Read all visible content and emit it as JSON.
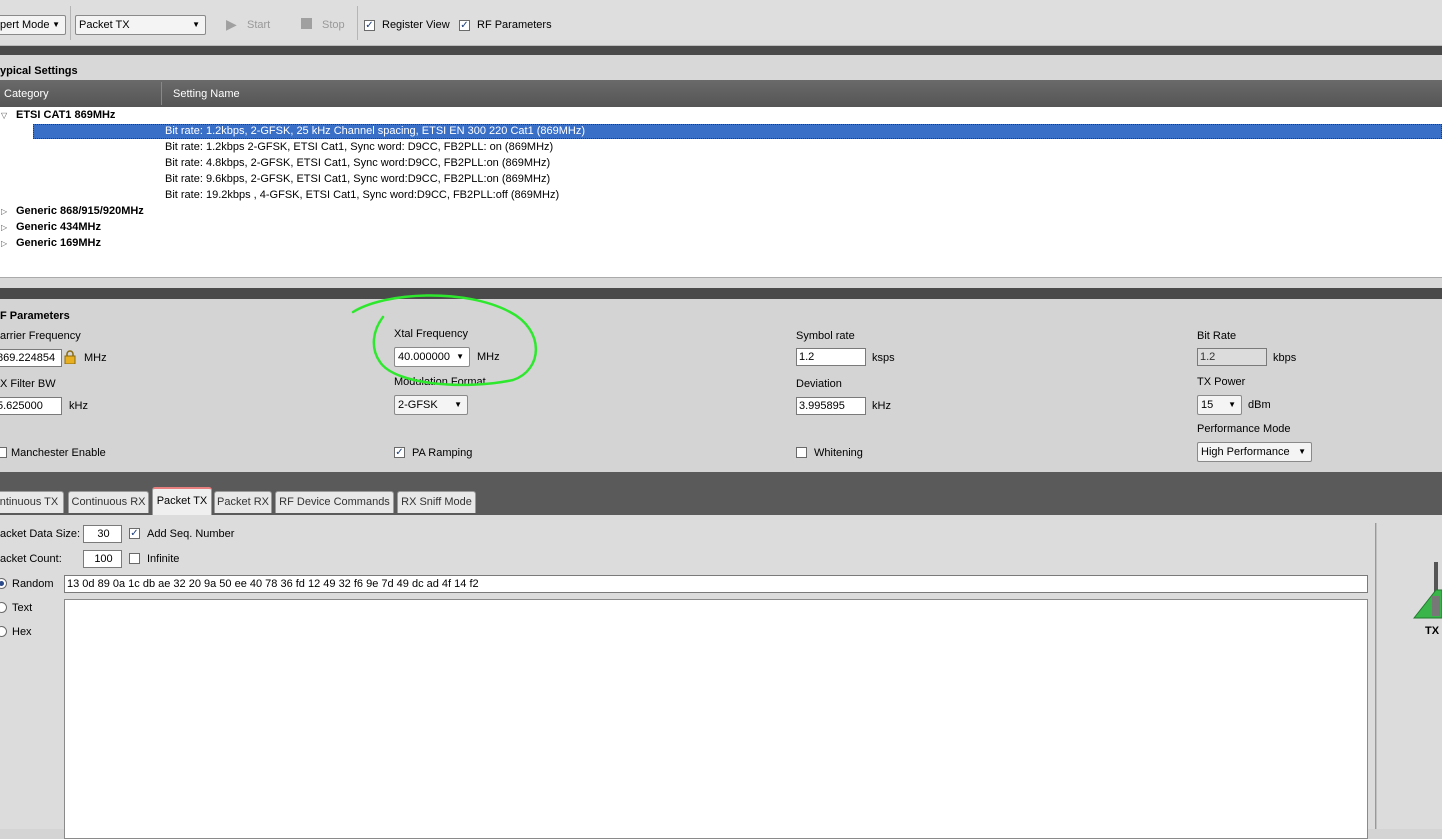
{
  "toolbar": {
    "mode_select": "pert Mode",
    "function_select": "Packet TX",
    "start_label": "Start",
    "stop_label": "Stop",
    "register_view_label": "Register View",
    "register_view_checked": true,
    "rf_parameters_label": "RF Parameters",
    "rf_parameters_checked": true
  },
  "typical_settings": {
    "title": "ypical Settings",
    "col_category": "Category",
    "col_setting_name": "Setting Name",
    "categories": [
      {
        "name": "ETSI CAT1 869MHz",
        "expanded": true,
        "settings": [
          "Bit rate: 1.2kbps, 2-GFSK, 25 kHz Channel spacing, ETSI EN 300 220 Cat1 (869MHz)",
          "Bit rate: 1.2kbps  2-GFSK, ETSI Cat1, Sync word: D9CC, FB2PLL: on (869MHz)",
          "Bit rate: 4.8kbps, 2-GFSK, ETSI Cat1, Sync word:D9CC, FB2PLL:on (869MHz)",
          "Bit rate: 9.6kbps, 2-GFSK, ETSI Cat1, Sync word:D9CC, FB2PLL:on (869MHz)",
          "Bit rate: 19.2kbps , 4-GFSK, ETSI Cat1, Sync word:D9CC, FB2PLL:off (869MHz)"
        ]
      },
      {
        "name": "Generic 868/915/920MHz",
        "expanded": false
      },
      {
        "name": "Generic 434MHz",
        "expanded": false
      },
      {
        "name": "Generic 169MHz",
        "expanded": false
      }
    ]
  },
  "rf_parameters": {
    "title": "F Parameters",
    "carrier_frequency": {
      "label": "arrier Frequency",
      "value": "869.224854",
      "unit": "MHz"
    },
    "xtal_frequency": {
      "label": "Xtal Frequency",
      "value": "40.000000",
      "unit": "MHz"
    },
    "symbol_rate": {
      "label": "Symbol rate",
      "value": "1.2",
      "unit": "ksps"
    },
    "bit_rate": {
      "label": "Bit Rate",
      "value": "1.2",
      "unit": "kbps"
    },
    "rx_filter_bw": {
      "label": "X Filter BW",
      "value": "5.625000",
      "unit": "kHz"
    },
    "modulation_format": {
      "label": "Modulation Format",
      "value": "2-GFSK"
    },
    "deviation": {
      "label": "Deviation",
      "value": "3.995895",
      "unit": "kHz"
    },
    "tx_power": {
      "label": "TX Power",
      "value": "15",
      "unit": "dBm"
    },
    "performance_mode": {
      "label": "Performance Mode",
      "value": "High Performance"
    },
    "manchester": {
      "label": "Manchester Enable",
      "checked": false
    },
    "pa_ramping": {
      "label": "PA Ramping",
      "checked": true
    },
    "whitening": {
      "label": "Whitening",
      "checked": false
    }
  },
  "tabs": [
    "ntinuous TX",
    "Continuous RX",
    "Packet TX",
    "Packet RX",
    "RF Device Commands",
    "RX Sniff Mode"
  ],
  "active_tab": "Packet TX",
  "packet_tx": {
    "data_size_label": "acket Data Size:",
    "data_size_value": "30",
    "add_seq_label": "Add Seq. Number",
    "add_seq_checked": true,
    "count_label": "acket Count:",
    "count_value": "100",
    "infinite_label": "Infinite",
    "infinite_checked": false,
    "radio_random": "Random",
    "radio_text": "Text",
    "radio_hex": "Hex",
    "selected_mode": "Random",
    "random_data": "13 0d 89 0a 1c db ae 32 20 9a 50 ee 40 78 36 fd 12 49 32 f6 9e 7d 49 dc ad 4f 14 f2",
    "tx_label": "TX"
  },
  "colors": {
    "dark_bar": "#4a4a4a",
    "selection": "#3a6fc8",
    "annotation": "#2ee82e",
    "tx_icon": "#39b54a"
  }
}
